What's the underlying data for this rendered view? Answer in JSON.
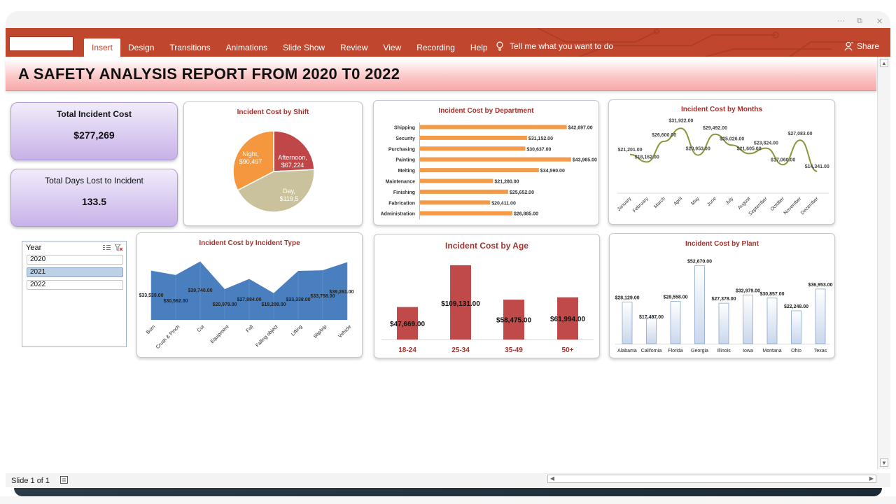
{
  "ribbon": {
    "tabs": [
      "Insert",
      "Design",
      "Transitions",
      "Animations",
      "Slide Show",
      "Review",
      "View",
      "Recording",
      "Help"
    ],
    "active_tab": "Insert",
    "tell_me": "Tell me what you want to do",
    "share": "Share",
    "color": "#c0462d"
  },
  "report": {
    "title": "A SAFETY ANALYSIS REPORT FROM 2020 T0 2022"
  },
  "kpis": {
    "total_cost_label": "Total Incident Cost",
    "total_cost_value": "$277,269",
    "days_lost_label": "Total Days Lost to Incident",
    "days_lost_value": "133.5"
  },
  "slicer": {
    "title": "Year",
    "items": [
      "2020",
      "2021",
      "2022"
    ],
    "selected": "2021"
  },
  "status": {
    "slide_info": "Slide 1 of 1"
  },
  "chart_data": [
    {
      "id": "shift",
      "type": "pie",
      "title": "Incident Cost by Shift",
      "categories": [
        "Afternoon",
        "Day",
        "Night"
      ],
      "values": [
        67224,
        119548,
        90497
      ],
      "labels": [
        "Afternoon,\n$67,224",
        "Day,\n$119,5",
        "Night,\n$90,497"
      ],
      "colors": [
        "#c04747",
        "#c9c29c",
        "#f5973f"
      ]
    },
    {
      "id": "department",
      "type": "bar",
      "orientation": "horizontal",
      "title": "Incident Cost by Department",
      "categories": [
        "Shipping",
        "Security",
        "Purchasing",
        "Painting",
        "Melting",
        "Maintenance",
        "Finishing",
        "Fabrication",
        "Administration"
      ],
      "values": [
        42697,
        31152,
        30637,
        43965,
        34590,
        21280,
        25652,
        20411,
        26885
      ],
      "labels": [
        "$42,697.00",
        "$31,152.00",
        "$30,637.00",
        "$43,965.00",
        "$34,590.00",
        "$21,280.00",
        "$25,652.00",
        "$20,411.00",
        "$26,885.00"
      ],
      "color": "#f39b47"
    },
    {
      "id": "months",
      "type": "line",
      "title": "Incident Cost by Months",
      "categories": [
        "January",
        "February",
        "March",
        "April",
        "May",
        "June",
        "July",
        "August",
        "September",
        "October",
        "November",
        "December"
      ],
      "values": [
        21201,
        18162,
        26600,
        31922,
        20953,
        29492,
        25026,
        21605,
        23824,
        17060,
        27083,
        14341
      ],
      "labels": [
        "$21,201.00",
        "$18,162.00",
        "$26,600.00",
        "$31,922.00",
        "$20,953.00",
        "$29,492.00",
        "$25,026.00",
        "$21,605.00",
        "$23,824.00",
        "$17,060.00",
        "$27,083.00",
        "$14,341.00"
      ],
      "color": "#86983a"
    },
    {
      "id": "incident_type",
      "type": "area",
      "title": "Incident Cost by Incident Type",
      "categories": [
        "Burn",
        "Crush & Pinch",
        "Cut",
        "Equipment",
        "Fall",
        "Falling object",
        "Lifting",
        "Slip/trip",
        "Vehicle"
      ],
      "values": [
        33539,
        30562,
        39740,
        20979,
        27884,
        18208,
        33338,
        33758,
        39261
      ],
      "labels": [
        "$33,539.00",
        "$30,562.00",
        "$39,740.00",
        "$20,979.00",
        "$27,884.00",
        "$18,208.00",
        "$33,338.00",
        "$33,758.00",
        "$39,261.00"
      ],
      "color": "#4a7fbf"
    },
    {
      "id": "age",
      "type": "bar",
      "title": "Incident Cost by Age",
      "categories": [
        "18-24",
        "25-34",
        "35-49",
        "50+"
      ],
      "values": [
        47669,
        109131,
        58475,
        61994
      ],
      "labels": [
        "$47,669.00",
        "$109,131.00",
        "$58,475.00",
        "$61,994.00"
      ],
      "color": "#c04a4a"
    },
    {
      "id": "plant",
      "type": "bar",
      "title": "Incident Cost by Plant",
      "categories": [
        "Alabama",
        "California",
        "Florida",
        "Georgia",
        "Illinois",
        "Iowa",
        "Montana",
        "Ohio",
        "Texas"
      ],
      "values": [
        28129,
        17497,
        28558,
        52670,
        27378,
        32979,
        30857,
        22248,
        36953
      ],
      "labels": [
        "$28,129.00",
        "$17,497.00",
        "$28,558.00",
        "$52,670.00",
        "$27,378.00",
        "$32,979.00",
        "$30,857.00",
        "$22,248.00",
        "$36,953.00"
      ],
      "color": "#c9d7ec"
    }
  ]
}
